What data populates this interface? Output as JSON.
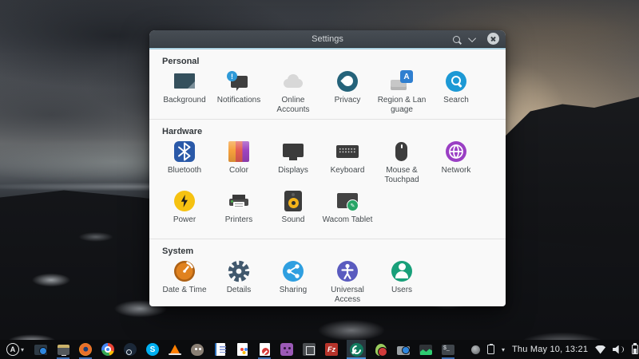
{
  "window": {
    "title": "Settings",
    "titlebar": {
      "icons": [
        "search-icon",
        "chevron-down-icon",
        "close-icon"
      ]
    },
    "sections": [
      {
        "title": "Personal",
        "items": [
          {
            "label": "Background",
            "icon": "background-icon"
          },
          {
            "label": "Notifications",
            "icon": "notifications-icon"
          },
          {
            "label": "Online\nAccounts",
            "icon": "online-accounts-icon"
          },
          {
            "label": "Privacy",
            "icon": "privacy-icon"
          },
          {
            "label": "Region & Lan\nguage",
            "icon": "region-language-icon"
          },
          {
            "label": "Search",
            "icon": "search-icon"
          }
        ]
      },
      {
        "title": "Hardware",
        "items": [
          {
            "label": "Bluetooth",
            "icon": "bluetooth-icon"
          },
          {
            "label": "Color",
            "icon": "color-icon"
          },
          {
            "label": "Displays",
            "icon": "displays-icon"
          },
          {
            "label": "Keyboard",
            "icon": "keyboard-icon"
          },
          {
            "label": "Mouse &\nTouchpad",
            "icon": "mouse-touchpad-icon"
          },
          {
            "label": "Network",
            "icon": "network-icon"
          },
          {
            "label": "Power",
            "icon": "power-icon"
          },
          {
            "label": "Printers",
            "icon": "printers-icon"
          },
          {
            "label": "Sound",
            "icon": "sound-icon"
          },
          {
            "label": "Wacom Tablet",
            "icon": "wacom-tablet-icon"
          }
        ]
      },
      {
        "title": "System",
        "items": [
          {
            "label": "Date & Time",
            "icon": "date-time-icon"
          },
          {
            "label": "Details",
            "icon": "details-icon"
          },
          {
            "label": "Sharing",
            "icon": "sharing-icon"
          },
          {
            "label": "Universal\nAccess",
            "icon": "universal-access-icon"
          },
          {
            "label": "Users",
            "icon": "users-icon"
          }
        ]
      }
    ]
  },
  "taskbar": {
    "clock": "Thu May 10, 13:21",
    "active_app": "settings-app",
    "apps": [
      "app-launcher",
      "screenshot-tool",
      "file-manager",
      "firefox",
      "chrome",
      "steam",
      "skype",
      "vlc",
      "gimp",
      "office-writer",
      "office-start",
      "document-editor",
      "purple-face-app",
      "frame-tool",
      "filezilla",
      "settings-app",
      "gnome-foot-app",
      "toolbox-app",
      "system-monitor",
      "terminal"
    ],
    "open_indicator_apps": [
      "file-manager",
      "firefox",
      "document-editor",
      "settings-app",
      "terminal"
    ],
    "tray": [
      "status-icon",
      "clipboard-icon",
      "clock",
      "wifi-icon",
      "volume-icon",
      "battery-icon",
      "chevron-down-icon"
    ]
  },
  "colors": {
    "titlebar": "#3d4349",
    "window_bg": "#f9f9f9",
    "accent_blue": "#4a90d9",
    "taskbar_bg": "#0b0c0e",
    "section_separator": "#e2e2e2"
  }
}
